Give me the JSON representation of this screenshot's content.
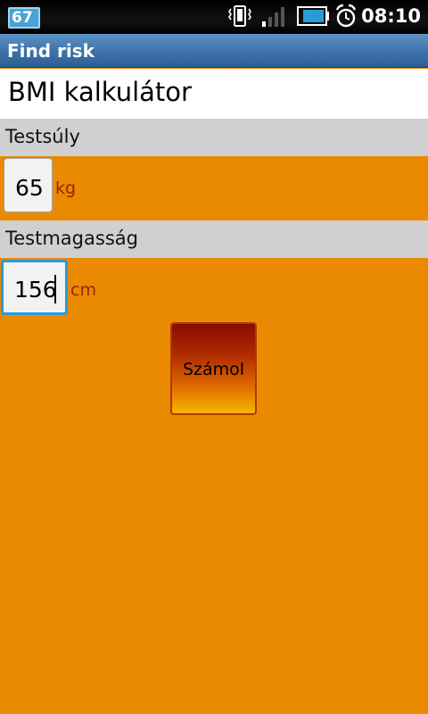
{
  "status_bar": {
    "notification_badge": "67",
    "time": "08:10",
    "icons": [
      "vibrate-icon",
      "signal-icon",
      "battery-icon",
      "alarm-icon"
    ]
  },
  "app": {
    "title": "Find risk"
  },
  "form": {
    "heading": "BMI kalkulátor",
    "weight_label": "Testsúly",
    "weight_value": "65",
    "weight_unit": "kg",
    "height_label": "Testmagasság",
    "height_value": "156",
    "height_unit": "cm",
    "calculate_label": "Számol"
  },
  "colors": {
    "background": "#E98A00",
    "title_bar": "#3f74aa",
    "section_label_bg": "#D0D0D0",
    "focus_border": "#2a9bd8",
    "unit_text": "#a02000"
  }
}
